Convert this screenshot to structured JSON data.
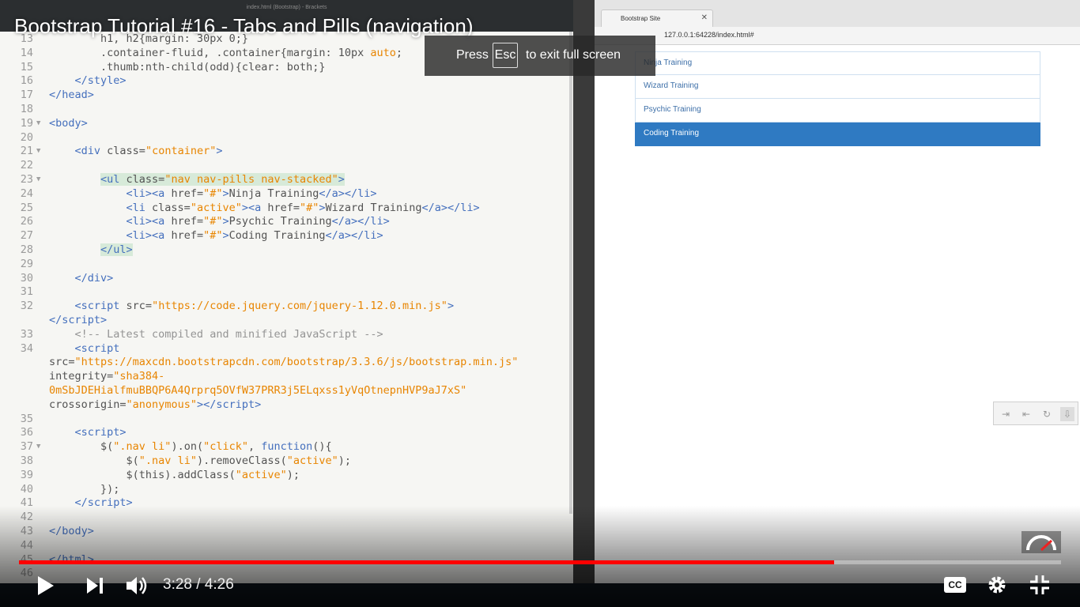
{
  "video": {
    "title": "Bootstrap Tutorial #16 - Tabs and Pills (navigation)",
    "current_time": "3:28",
    "duration": "4:26",
    "time_display": "3:28 / 4:26",
    "progress_fraction": 0.782,
    "cc_label": "CC"
  },
  "fullscreen_notice": {
    "press": "Press",
    "key": "Esc",
    "text": "to exit full screen"
  },
  "editor": {
    "window_title": "index.html (Bootstrap) - Brackets",
    "lines": [
      {
        "num": "13",
        "fold": "",
        "html": "<span class=\"attr\">        h1, h2{margin: 30px 0;}</span>"
      },
      {
        "num": "14",
        "fold": "",
        "html": "<span class=\"attr\">        .container-fluid, .container{margin: 10px </span><span class=\"str\">auto</span><span class=\"attr\">;</span>"
      },
      {
        "num": "15",
        "fold": "",
        "html": "<span class=\"attr\">        .thumb:nth-child(odd){clear: both;}</span>"
      },
      {
        "num": "16",
        "fold": "",
        "html": "<span class=\"tag\">    &lt;/style&gt;</span>"
      },
      {
        "num": "17",
        "fold": "",
        "html": "<span class=\"tag\">&lt;/head&gt;</span>"
      },
      {
        "num": "18",
        "fold": "",
        "html": ""
      },
      {
        "num": "19",
        "fold": "▼",
        "html": "<span class=\"tag\">&lt;body&gt;</span>"
      },
      {
        "num": "20",
        "fold": "",
        "html": ""
      },
      {
        "num": "21",
        "fold": "▼",
        "html": "<span class=\"tag\">    &lt;div </span><span class=\"attr\">class=</span><span class=\"str\">\"container\"</span><span class=\"tag\">&gt;</span>"
      },
      {
        "num": "22",
        "fold": "",
        "html": ""
      },
      {
        "num": "23",
        "fold": "▼",
        "html": "        <span class=\"hl\"><span class=\"tag\">&lt;ul </span><span class=\"attr\">class=</span><span class=\"str\">\"nav nav-pills nav-stacked\"</span><span class=\"tag\">&gt;</span></span>"
      },
      {
        "num": "24",
        "fold": "",
        "html": "<span class=\"tag\">            &lt;li&gt;&lt;a </span><span class=\"attr\">href=</span><span class=\"str\">\"#\"</span><span class=\"tag\">&gt;</span><span class=\"attr\">Ninja Training</span><span class=\"tag\">&lt;/a&gt;&lt;/li&gt;</span>"
      },
      {
        "num": "25",
        "fold": "",
        "html": "<span class=\"tag\">            &lt;li </span><span class=\"attr\">class=</span><span class=\"str\">\"active\"</span><span class=\"tag\">&gt;&lt;a </span><span class=\"attr\">href=</span><span class=\"str\">\"#\"</span><span class=\"tag\">&gt;</span><span class=\"attr\">Wizard Training</span><span class=\"tag\">&lt;/a&gt;&lt;/li&gt;</span>"
      },
      {
        "num": "26",
        "fold": "",
        "html": "<span class=\"tag\">            &lt;li&gt;&lt;a </span><span class=\"attr\">href=</span><span class=\"str\">\"#\"</span><span class=\"tag\">&gt;</span><span class=\"attr\">Psychic Training</span><span class=\"tag\">&lt;/a&gt;&lt;/li&gt;</span>"
      },
      {
        "num": "27",
        "fold": "",
        "html": "<span class=\"tag\">            &lt;li&gt;&lt;a </span><span class=\"attr\">href=</span><span class=\"str\">\"#\"</span><span class=\"tag\">&gt;</span><span class=\"attr\">Coding Training</span><span class=\"tag\">&lt;/a&gt;&lt;/li&gt;</span>"
      },
      {
        "num": "28",
        "fold": "",
        "html": "        <span class=\"hl\"><span class=\"tag\">&lt;/ul&gt;</span></span>"
      },
      {
        "num": "29",
        "fold": "",
        "html": ""
      },
      {
        "num": "30",
        "fold": "",
        "html": "<span class=\"tag\">    &lt;/div&gt;</span>"
      },
      {
        "num": "31",
        "fold": "",
        "html": ""
      },
      {
        "num": "32",
        "fold": "",
        "html": "<span class=\"tag\">    &lt;script </span><span class=\"attr\">src=</span><span class=\"str\">\"https://code.jquery.com/jquery-1.12.0.min.js\"</span><span class=\"tag\">&gt;</span>"
      },
      {
        "num": "",
        "fold": "",
        "html": "<span class=\"tag\">&lt;/script&gt;</span>"
      },
      {
        "num": "33",
        "fold": "",
        "html": "<span class=\"cmt\">    &lt;!-- Latest compiled and minified JavaScript --&gt;</span>"
      },
      {
        "num": "34",
        "fold": "",
        "html": "<span class=\"tag\">    &lt;script</span>"
      },
      {
        "num": "",
        "fold": "",
        "html": "<span class=\"attr\">src=</span><span class=\"str\">\"https://maxcdn.bootstrapcdn.com/bootstrap/3.3.6/js/bootstrap.min.js\"</span>"
      },
      {
        "num": "",
        "fold": "",
        "html": "<span class=\"attr\">integrity=</span><span class=\"str\">\"sha384-</span>"
      },
      {
        "num": "",
        "fold": "",
        "html": "<span class=\"str\">0mSbJDEHialfmuBBQP6A4Qrprq5OVfW37PRR3j5ELqxss1yVqOtnepnHVP9aJ7xS\"</span>"
      },
      {
        "num": "",
        "fold": "",
        "html": "<span class=\"attr\">crossorigin=</span><span class=\"str\">\"anonymous\"</span><span class=\"tag\">&gt;&lt;/script&gt;</span>"
      },
      {
        "num": "35",
        "fold": "",
        "html": ""
      },
      {
        "num": "36",
        "fold": "",
        "html": "<span class=\"tag\">    &lt;script&gt;</span>"
      },
      {
        "num": "37",
        "fold": "▼",
        "html": "<span class=\"attr\">        $(</span><span class=\"str\">\".nav li\"</span><span class=\"attr\">).on(</span><span class=\"str\">\"click\"</span><span class=\"attr\">, </span><span class=\"tag\">function</span><span class=\"attr\">(){</span>"
      },
      {
        "num": "38",
        "fold": "",
        "html": "<span class=\"attr\">            $(</span><span class=\"str\">\".nav li\"</span><span class=\"attr\">).removeClass(</span><span class=\"str\">\"active\"</span><span class=\"attr\">);</span>"
      },
      {
        "num": "39",
        "fold": "",
        "html": "<span class=\"attr\">            $(this).addClass(</span><span class=\"str\">\"active\"</span><span class=\"attr\">);</span>"
      },
      {
        "num": "40",
        "fold": "",
        "html": "<span class=\"attr\">        });</span>"
      },
      {
        "num": "41",
        "fold": "",
        "html": "<span class=\"tag\">    &lt;/script&gt;</span>"
      },
      {
        "num": "42",
        "fold": "",
        "html": ""
      },
      {
        "num": "43",
        "fold": "",
        "html": "<span class=\"tag\">&lt;/body&gt;</span>"
      },
      {
        "num": "44",
        "fold": "",
        "html": ""
      },
      {
        "num": "45",
        "fold": "",
        "html": "<span class=\"tag\">&lt;/html&gt;</span>"
      },
      {
        "num": "46",
        "fold": "",
        "html": ""
      }
    ]
  },
  "browser": {
    "tab_title": "Bootstrap Site",
    "url": "127.0.0.1:64228/index.html#",
    "nav_items": [
      {
        "label": "Ninja Training",
        "active": false
      },
      {
        "label": "Wizard Training",
        "active": false
      },
      {
        "label": "Psychic Training",
        "active": false
      },
      {
        "label": "Coding Training",
        "active": true
      }
    ]
  },
  "colors": {
    "progress": "#ff0000",
    "active_pill": "#2f7ac2"
  }
}
